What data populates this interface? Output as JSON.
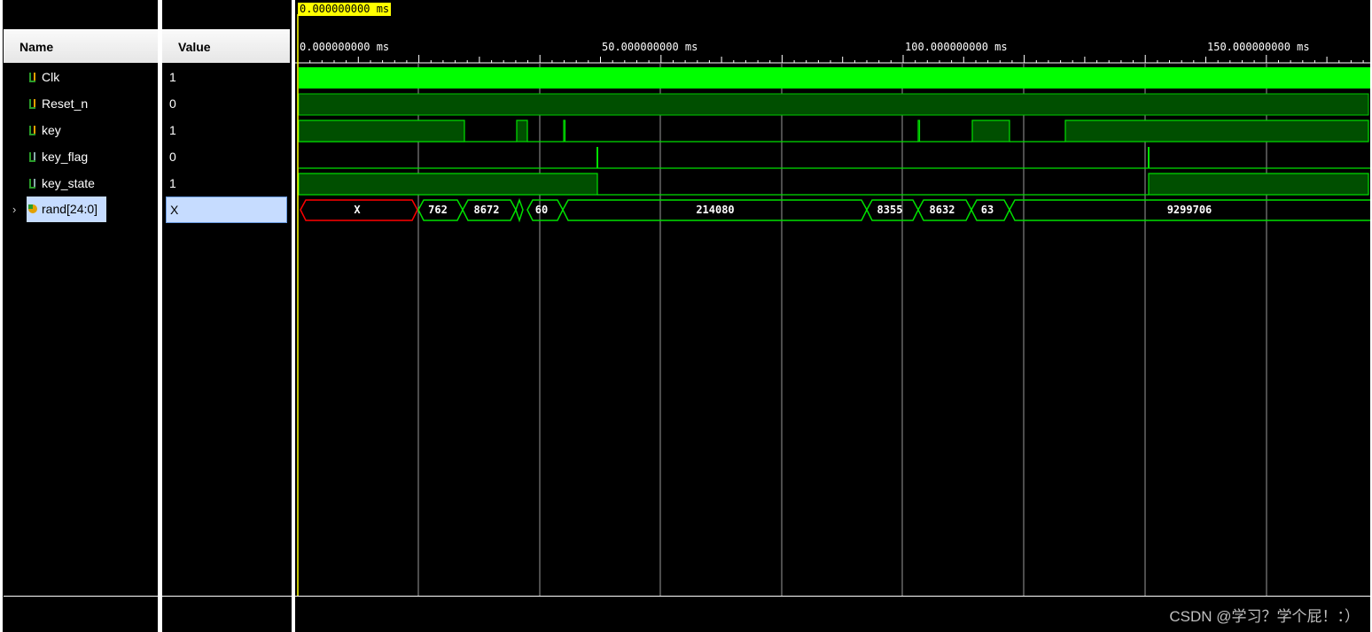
{
  "columns": {
    "name": "Name",
    "value": "Value"
  },
  "cursor_time": "0.000000000 ms",
  "ruler_labels": [
    "0.000000000 ms",
    "50.000000000 ms",
    "100.000000000 ms",
    "150.000000000 ms"
  ],
  "signals": [
    {
      "name": "Clk",
      "value": "1",
      "icon": "signal-bit-icon"
    },
    {
      "name": "Reset_n",
      "value": "0",
      "icon": "signal-bit-icon"
    },
    {
      "name": "key",
      "value": "1",
      "icon": "signal-bit-icon"
    },
    {
      "name": "key_flag",
      "value": "0",
      "icon": "signal-bit-icon"
    },
    {
      "name": "key_state",
      "value": "1",
      "icon": "signal-bit-icon"
    },
    {
      "name": "rand[24:0]",
      "value": "X",
      "icon": "signal-bus-icon",
      "expandable": true,
      "selected": true
    }
  ],
  "bus_values": [
    "X",
    "762",
    "8672",
    "60",
    "214080",
    "8355",
    "8632",
    "63",
    "9299706"
  ],
  "colors": {
    "wave": "#00ff00",
    "wave_dim": "#004f00",
    "unknown": "#ff0000",
    "cursor": "#ffff00",
    "selection": "#c6dcff"
  },
  "watermark": "CSDN @学习？学个屁！：）"
}
